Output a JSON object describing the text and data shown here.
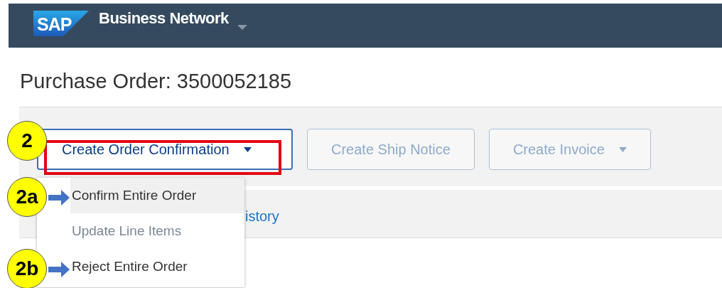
{
  "header": {
    "logo": "SAP",
    "title": "Business Network",
    "has_menu": true
  },
  "page_title": "Purchase Order: 3500052185",
  "toolbar": [
    {
      "label": "Create Order Confirmation",
      "dropdown": true,
      "disabled": false,
      "open": true
    },
    {
      "label": "Create Ship Notice",
      "dropdown": false,
      "disabled": true,
      "open": false
    },
    {
      "label": "Create Invoice",
      "dropdown": true,
      "disabled": true,
      "open": false
    }
  ],
  "tab_link": "istory",
  "menu": [
    {
      "label": "Confirm Entire Order",
      "selected": true,
      "disabled": false
    },
    {
      "label": "Update Line Items",
      "selected": false,
      "disabled": true
    },
    {
      "label": "Reject Entire Order",
      "selected": false,
      "disabled": false
    }
  ],
  "callouts": [
    {
      "label": "2",
      "kind": "box"
    },
    {
      "label": "2a",
      "kind": "arrow"
    },
    {
      "label": "2b",
      "kind": "arrow"
    }
  ]
}
